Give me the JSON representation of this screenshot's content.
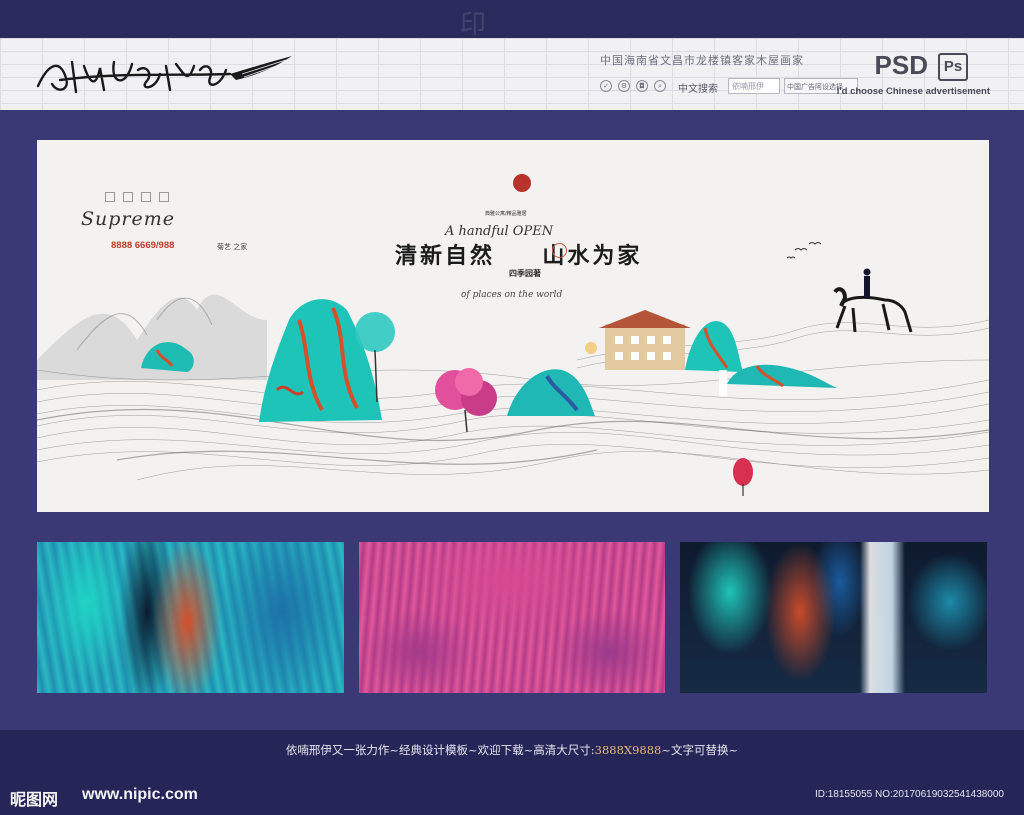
{
  "header": {
    "tagline": "中国海南省文昌市龙楼镇客家木屋画家",
    "search_label": "中文搜索",
    "search_placeholder": "依喃邢伊",
    "search_scope": "中国广告阿设选择",
    "psd_badge": "PSD",
    "ps_icon": "Ps",
    "choose_text": "I'd choose Chinese advertisement"
  },
  "poster": {
    "brand_logo": "Supreme",
    "brand_phone": "8888 6669/988",
    "deco_text": "菊艺 之家",
    "headline_en_top": "A handful OPEN",
    "headline_cn_left": "清新自然",
    "headline_cn_right": "山水为家",
    "subtitle_tag": "四季园著",
    "headline_en_bottom": "of places on the world",
    "caption_line": "典雅公寓/精品雅居"
  },
  "thumbnails": [
    {
      "name": "teal-orange-texture"
    },
    {
      "name": "pink-tree-texture"
    },
    {
      "name": "waterfall-texture"
    }
  ],
  "footer": {
    "caption_prefix": "依喃邢伊又一张力作~经典设计模板~欢迎下载~高清大尺寸:",
    "caption_size": "3888X9888",
    "caption_suffix": "~文字可替换~",
    "site_logo": "昵图网",
    "site_url": "www.nipic.com",
    "image_id": "ID:18155055 NO:20170619032541438000"
  },
  "colors": {
    "frame": "#2b2a5e",
    "panel": "#3a3975",
    "accent_teal": "#1fc4b8",
    "accent_orange": "#d5502a",
    "accent_pink": "#d84a92",
    "seal_red": "#b8322a"
  }
}
